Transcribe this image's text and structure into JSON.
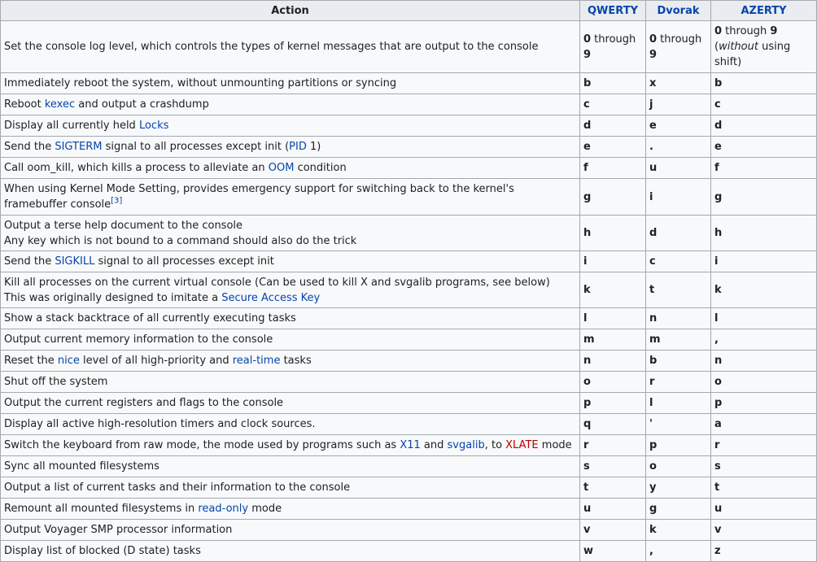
{
  "headers": {
    "action": "Action",
    "qwerty": "QWERTY",
    "dvorak": "Dvorak",
    "azerty": "AZERTY"
  },
  "rows": [
    {
      "action": "Set the console log level, which controls the types of kernel messages that are output to the console",
      "qwerty": {
        "from": "0",
        "mid": " through ",
        "to": "9"
      },
      "dvorak": {
        "from": "0",
        "mid": " through ",
        "to": "9"
      },
      "azerty": {
        "from": "0",
        "mid": " through ",
        "to": "9",
        "paren_open": "(",
        "italic": "without",
        "rest": " using shift)"
      }
    },
    {
      "action": "Immediately reboot the system, without unmounting partitions or syncing",
      "qwerty": "b",
      "dvorak": "x",
      "azerty": "b"
    },
    {
      "action_parts": [
        "Reboot ",
        "kexec",
        " and output a crashdump"
      ],
      "qwerty": "c",
      "dvorak": "j",
      "azerty": "c"
    },
    {
      "action_parts": [
        "Display all currently held ",
        "Locks"
      ],
      "qwerty": "d",
      "dvorak": "e",
      "azerty": "d"
    },
    {
      "action_parts": [
        "Send the ",
        "SIGTERM",
        " signal to all processes except init (",
        "PID",
        " 1)"
      ],
      "qwerty": "e",
      "dvorak": ".",
      "azerty": "e"
    },
    {
      "action_parts": [
        "Call oom_kill, which kills a process to alleviate an ",
        "OOM",
        " condition"
      ],
      "qwerty": "f",
      "dvorak": "u",
      "azerty": "f"
    },
    {
      "action_parts": [
        "When using Kernel Mode Setting, provides emergency support for switching back to the kernel's framebuffer console",
        "[3]"
      ],
      "qwerty": "g",
      "dvorak": "i",
      "azerty": "g"
    },
    {
      "action_lines": [
        "Output a terse help document to the console",
        "Any key which is not bound to a command should also do the trick"
      ],
      "qwerty": "h",
      "dvorak": "d",
      "azerty": "h"
    },
    {
      "action_parts": [
        "Send the ",
        "SIGKILL",
        " signal to all processes except init"
      ],
      "qwerty": "i",
      "dvorak": "c",
      "azerty": "i"
    },
    {
      "action_lines": [
        "Kill all processes on the current virtual console (Can be used to kill X and svgalib programs, see below)",
        "This was originally designed to imitate a ",
        "Secure Access Key"
      ],
      "qwerty": "k",
      "dvorak": "t",
      "azerty": "k"
    },
    {
      "action": "Show a stack backtrace of all currently executing tasks",
      "qwerty": "l",
      "dvorak": "n",
      "azerty": "l"
    },
    {
      "action": "Output current memory information to the console",
      "qwerty": "m",
      "dvorak": "m",
      "azerty": ","
    },
    {
      "action_parts": [
        "Reset the ",
        "nice",
        " level of all high-priority and ",
        "real-time",
        " tasks"
      ],
      "qwerty": "n",
      "dvorak": "b",
      "azerty": "n"
    },
    {
      "action": "Shut off the system",
      "qwerty": "o",
      "dvorak": "r",
      "azerty": "o"
    },
    {
      "action": "Output the current registers and flags to the console",
      "qwerty": "p",
      "dvorak": "l",
      "azerty": "p"
    },
    {
      "action": "Display all active high-resolution timers and clock sources.",
      "qwerty": "q",
      "dvorak": "'",
      "azerty": "a"
    },
    {
      "action_parts": [
        "Switch the keyboard from raw mode, the mode used by programs such as ",
        "X11",
        " and ",
        "svgalib",
        ", to ",
        "XLATE",
        " mode"
      ],
      "qwerty": "r",
      "dvorak": "p",
      "azerty": "r"
    },
    {
      "action": "Sync all mounted filesystems",
      "qwerty": "s",
      "dvorak": "o",
      "azerty": "s"
    },
    {
      "action": "Output a list of current tasks and their information to the console",
      "qwerty": "t",
      "dvorak": "y",
      "azerty": "t"
    },
    {
      "action_parts": [
        "Remount all mounted filesystems in ",
        "read-only",
        " mode"
      ],
      "qwerty": "u",
      "dvorak": "g",
      "azerty": "u"
    },
    {
      "action": "Output Voyager SMP processor information",
      "qwerty": "v",
      "dvorak": "k",
      "azerty": "v"
    },
    {
      "action": "Display list of blocked (D state) tasks",
      "qwerty": "w",
      "dvorak": ",",
      "azerty": "z"
    }
  ],
  "colors": {
    "link": "#0645ad",
    "redlink": "#ba0000",
    "border": "#a2a9b1",
    "header_bg": "#eaecf0",
    "cell_bg": "#f8f9fa"
  }
}
